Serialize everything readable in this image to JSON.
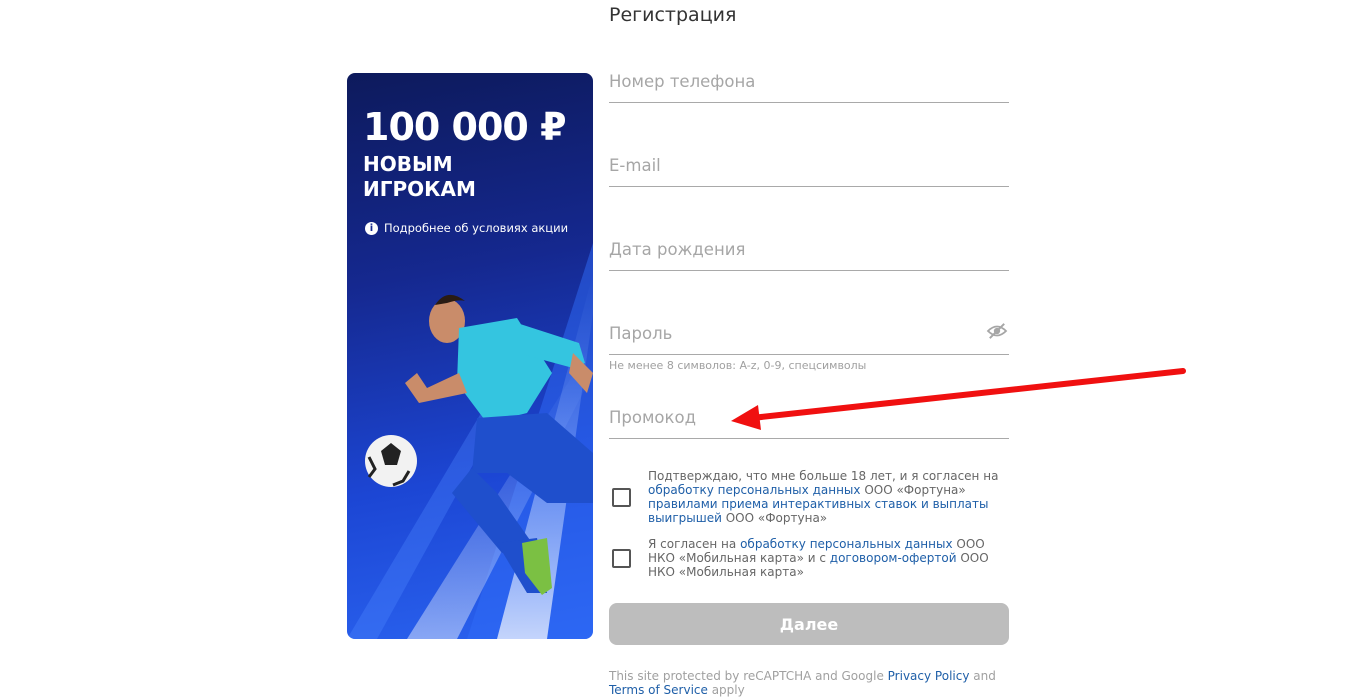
{
  "page": {
    "title": "Регистрация"
  },
  "banner": {
    "amount": "100 000 ₽",
    "subtitle_line1": "НОВЫМ",
    "subtitle_line2": "ИГРОКАМ",
    "info_link": "Подробнее об условиях акции",
    "info_icon": "info-icon"
  },
  "form": {
    "phone_placeholder": "Номер телефона",
    "email_placeholder": "E-mail",
    "birthdate_placeholder": "Дата рождения",
    "password_placeholder": "Пароль",
    "password_hint": "Не менее 8 символов: A-z, 0-9, спецсимволы",
    "promo_placeholder": "Промокод",
    "password_toggle_icon": "eye-slash-icon"
  },
  "consent1": {
    "text_a": "Подтверждаю, что мне больше 18 лет, и я согласен на ",
    "link_a": "обработку персональных данных",
    "text_b": " ООО «Фортуна» ",
    "link_b": "правилами приема интерактивных ставок и выплаты выигрышей",
    "text_c": " ООО «Фортуна»"
  },
  "consent2": {
    "text_a": "Я согласен на ",
    "link_a": "обработку персональных данных",
    "text_b": " ООО НКО «Мобильная карта» и с ",
    "link_b": "договором-офертой",
    "text_c": " ООО НКО «Мобильная карта»"
  },
  "submit_label": "Далее",
  "footer": {
    "text_a": "This site protected by reCAPTCHA and Google ",
    "link_privacy": "Privacy Policy",
    "text_b": " and ",
    "link_terms": "Terms of Service",
    "text_c": " apply"
  },
  "colors": {
    "link": "#1f5fa8",
    "button_disabled": "#bdbdbd",
    "annotation_arrow": "#f01010",
    "banner_dark": "#0d1a5c",
    "banner_light": "#2a63f0"
  }
}
